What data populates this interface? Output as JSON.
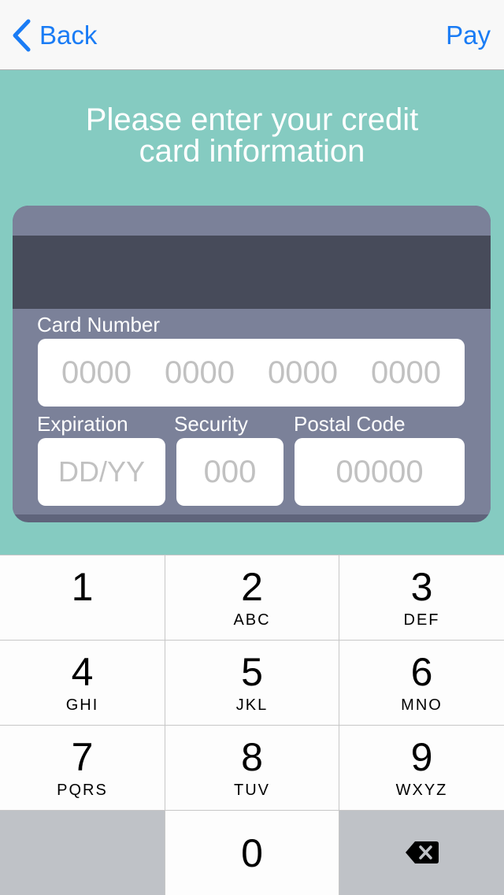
{
  "navbar": {
    "back_label": "Back",
    "pay_label": "Pay",
    "accent_color": "#1a7cf5"
  },
  "prompt": {
    "line1": "Please enter your credit",
    "line2": "card information"
  },
  "card": {
    "card_number_label": "Card Number",
    "card_number_placeholder": [
      "0000",
      "0000",
      "0000",
      "0000"
    ],
    "expiration_label": "Expiration",
    "expiration_placeholder": "DD/YY",
    "security_label": "Security",
    "security_placeholder": "000",
    "postal_label": "Postal Code",
    "postal_placeholder": "00000"
  },
  "keypad": {
    "keys": [
      {
        "num": "1",
        "letters": ""
      },
      {
        "num": "2",
        "letters": "ABC"
      },
      {
        "num": "3",
        "letters": "DEF"
      },
      {
        "num": "4",
        "letters": "GHI"
      },
      {
        "num": "5",
        "letters": "JKL"
      },
      {
        "num": "6",
        "letters": "MNO"
      },
      {
        "num": "7",
        "letters": "PQRS"
      },
      {
        "num": "8",
        "letters": "TUV"
      },
      {
        "num": "9",
        "letters": "WXYZ"
      },
      {
        "num": "0",
        "letters": ""
      }
    ],
    "delete_icon": "backspace-icon"
  },
  "colors": {
    "background": "#85cbc1",
    "card_face": "#7b8199",
    "mag_stripe": "#474b5a",
    "placeholder": "#c1c1c1"
  }
}
